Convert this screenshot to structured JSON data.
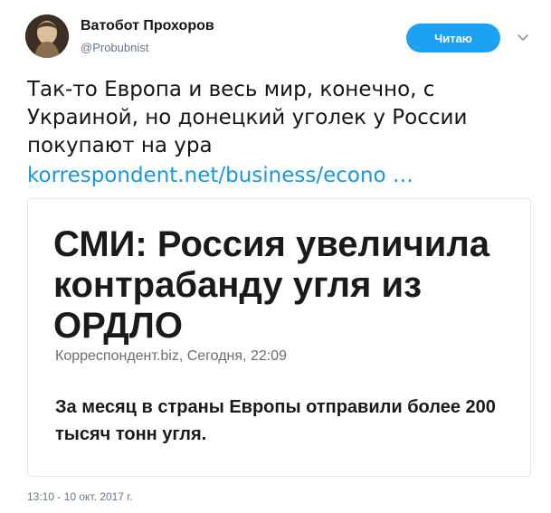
{
  "author": {
    "display_name": "Ватобот Прохоров",
    "username": "@Probubnist"
  },
  "follow_button": {
    "label": "Читаю",
    "color": "#1da1f2"
  },
  "menu_caret_icon": "chevron-down-icon",
  "tweet": {
    "text": "Так-то Европа и весь мир, конечно, с Украиной, но донецкий уголек у России покупают на ура",
    "link": "korrespondent.net/business/econo   …",
    "link_color": "#1b95e0"
  },
  "card": {
    "headline": "СМИ: Россия увеличила контрабанду угля из ОРДЛО",
    "meta": "Корреспондент.biz, Сегодня, 22:09",
    "lead": "За месяц в страны Европы отправили более 200 тысяч тонн угля."
  },
  "timestamp": "13:10 - 10 окт. 2017 г."
}
